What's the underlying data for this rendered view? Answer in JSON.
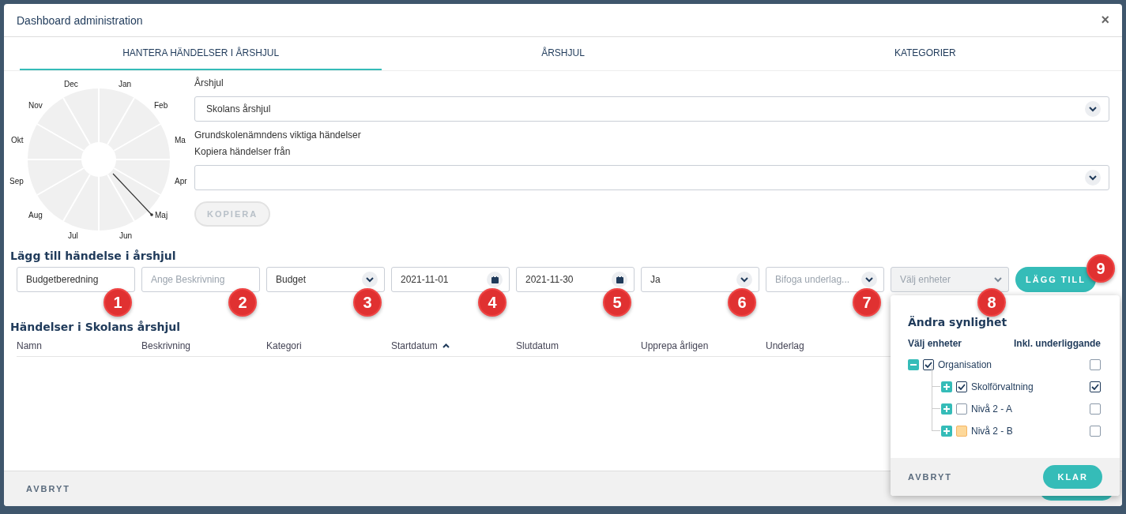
{
  "window": {
    "title": "Dashboard administration",
    "close": "×"
  },
  "tabs": [
    {
      "label": "HANTERA HÄNDELSER I ÅRSHJUL",
      "selected": true
    },
    {
      "label": "ÅRSHJUL",
      "selected": false
    },
    {
      "label": "KATEGORIER",
      "selected": false
    }
  ],
  "wheel": {
    "months": [
      "Jan",
      "Feb",
      "Ma",
      "Apr",
      "Maj",
      "Jun",
      "Jul",
      "Aug",
      "Sep",
      "Okt",
      "Nov",
      "Dec"
    ]
  },
  "form": {
    "wheel_label": "Årshjul",
    "wheel_value": "Skolans årshjul",
    "description": "Grundskolenämndens viktiga händelser",
    "copy_label": "Kopiera händelser från",
    "copy_button": {
      "label": "KOPIERA",
      "disabled": true
    }
  },
  "add_section": {
    "title": "Lägg till händelse i årshjul",
    "controls": [
      {
        "kind": "text",
        "value": "Budgetberedning",
        "badge": "1"
      },
      {
        "kind": "text",
        "placeholder": "Ange Beskrivning",
        "badge": "2"
      },
      {
        "kind": "select",
        "value": "Budget",
        "badge": "3"
      },
      {
        "kind": "date",
        "value": "2021-11-01",
        "badge": "4"
      },
      {
        "kind": "date",
        "value": "2021-11-30",
        "badge": "5"
      },
      {
        "kind": "select",
        "value": "Ja",
        "badge": "6"
      },
      {
        "kind": "select",
        "placeholder": "Bifoga underlag...",
        "badge": "7"
      },
      {
        "kind": "select",
        "placeholder": "Välj enheter",
        "disabled": true,
        "badge": "8"
      },
      {
        "kind": "button",
        "label": "LÄGG TILL",
        "badge": "9"
      }
    ]
  },
  "table": {
    "title": "Händelser i Skolans årshjul",
    "columns": [
      {
        "label": "Namn",
        "sorted": false
      },
      {
        "label": "Beskrivning",
        "sorted": false
      },
      {
        "label": "Kategori",
        "sorted": false
      },
      {
        "label": "Startdatum",
        "sorted": true
      },
      {
        "label": "Slutdatum",
        "sorted": false
      },
      {
        "label": "Upprepa årligen",
        "sorted": false
      },
      {
        "label": "Underlag",
        "sorted": false
      }
    ]
  },
  "footer": {
    "cancel": "AVBRYT"
  },
  "popup": {
    "title": "Ändra synlighet",
    "col_units": "Välj enheter",
    "col_include": "Inkl. underliggande",
    "tree": [
      {
        "label": "Organisation",
        "expanded": true,
        "checked": true,
        "partial": false,
        "include": false,
        "children": [
          {
            "label": "Skolförvaltning",
            "expanded": false,
            "checked": true,
            "partial": false,
            "include": true
          },
          {
            "label": "Nivå 2 - A",
            "expanded": false,
            "checked": false,
            "partial": false,
            "include": false
          },
          {
            "label": "Nivå 2 - B",
            "expanded": false,
            "checked": false,
            "partial": true,
            "include": false
          }
        ]
      }
    ],
    "cancel": "AVBRYT",
    "confirm": "KLAR"
  }
}
